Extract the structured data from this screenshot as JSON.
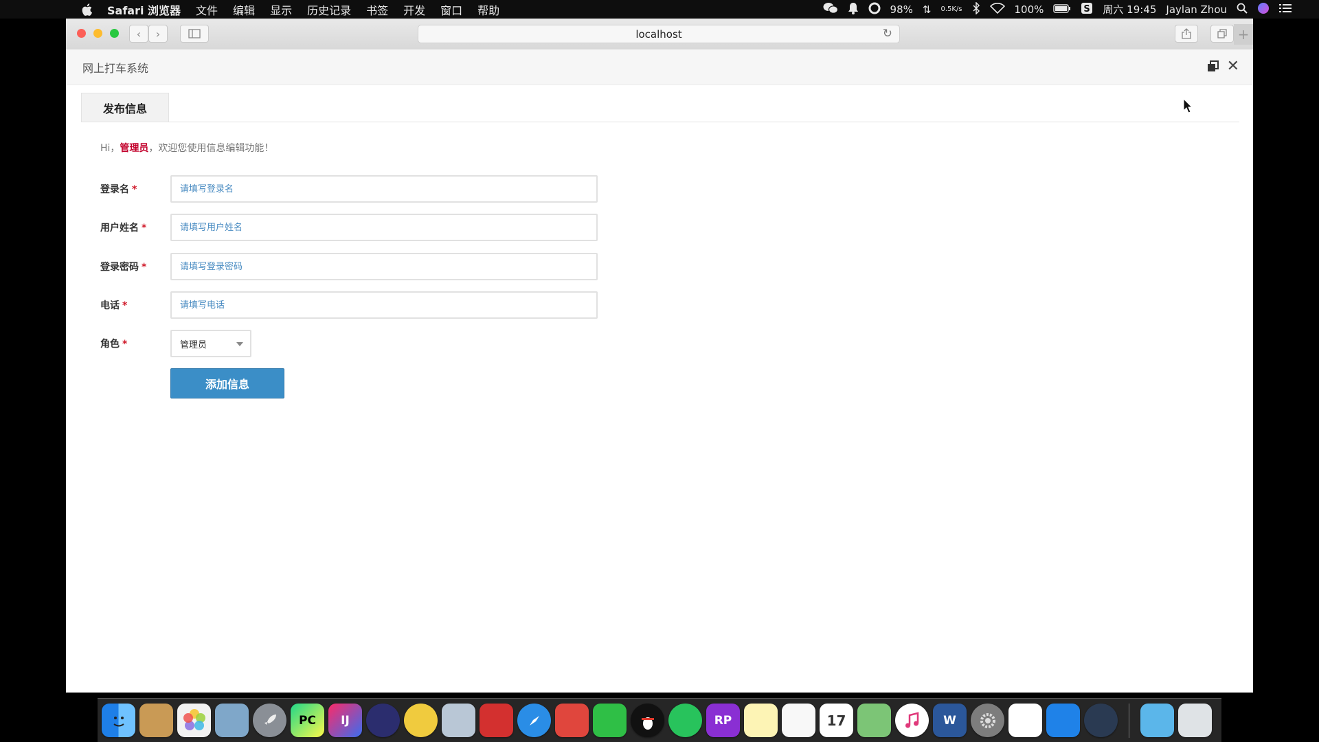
{
  "menubar": {
    "app_name": "Safari 浏览器",
    "menus": [
      "文件",
      "编辑",
      "显示",
      "历史记录",
      "书签",
      "开发",
      "窗口",
      "帮助"
    ],
    "status": {
      "cpu_percent": "98%",
      "net_speed": "0.5K/s",
      "battery": "100%",
      "datetime": "周六 19:45",
      "user": "Jaylan Zhou"
    }
  },
  "browser": {
    "address": "localhost"
  },
  "page": {
    "system_title": "网上打车系统",
    "tab_label": "发布信息",
    "welcome": {
      "prefix": "Hi，",
      "role_name": "管理员",
      "suffix": "，欢迎您使用信息编辑功能！"
    },
    "form": {
      "login_label": "登录名",
      "login_placeholder": "请填写登录名",
      "username_label": "用户姓名",
      "username_placeholder": "请填写用户姓名",
      "password_label": "登录密码",
      "password_placeholder": "请填写登录密码",
      "phone_label": "电话",
      "phone_placeholder": "请填写电话",
      "role_label": "角色",
      "role_value": "管理员",
      "required_mark": "*",
      "submit_label": "添加信息"
    }
  },
  "dock": {
    "calendar_day": "17"
  },
  "colors": {
    "primary_button": "#3b8ec7",
    "required_mark": "#d01a2a",
    "placeholder": "#4a8cc2"
  }
}
